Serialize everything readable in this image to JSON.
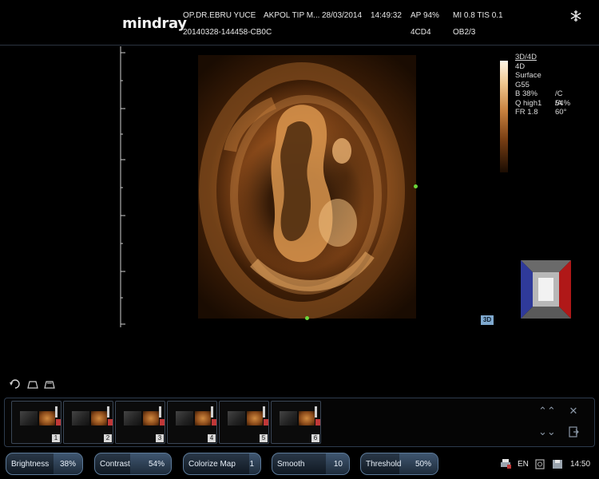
{
  "header": {
    "brand": "mindray",
    "doctor": "OP.DR.EBRU YUCE",
    "hospital": "AKPOL TIP M...",
    "date": "28/03/2014",
    "time": "14:49:32",
    "ap": "AP  94%",
    "mi_tis": "MI 0.8  TIS 0.1",
    "exam_id": "20140328-144458-CB0C",
    "probe": "4CD4",
    "preset": "OB2/3"
  },
  "params": {
    "mode": "3D/4D",
    "lines": [
      "4D",
      "Surface",
      "G55",
      "B 38%",
      "Q high1",
      "FR 1.8"
    ],
    "col2": [
      "/C 54%",
      "/A 60°"
    ]
  },
  "badge_3d": "3D",
  "icons": {
    "settings": "snowflake-icon",
    "rotate": "rotate-icon",
    "render_box1": "render-box-icon",
    "render_box2": "render-box-alt-icon",
    "orientation": "orientation-cube-icon",
    "up": "double-chevron-up-icon",
    "down": "double-chevron-down-icon",
    "close": "close-icon",
    "export": "export-icon",
    "printer": "printer-icon",
    "lang": "EN",
    "recycle": "recycle-icon",
    "disk": "disk-icon"
  },
  "thumbnails": [
    {
      "num": "1"
    },
    {
      "num": "2"
    },
    {
      "num": "3"
    },
    {
      "num": "4"
    },
    {
      "num": "5"
    },
    {
      "num": "6"
    }
  ],
  "controls": [
    {
      "label": "Brightness",
      "value": "38%",
      "level": 0.38
    },
    {
      "label": "Contrast",
      "value": "54%",
      "level": 0.54
    },
    {
      "label": "Colorize Map",
      "value": "1",
      "level": 0.15
    },
    {
      "label": "Smooth",
      "value": "10",
      "level": 0.3
    },
    {
      "label": "Threshold",
      "value": "50%",
      "level": 0.5
    }
  ],
  "tray": {
    "lang": "EN",
    "clock": "14:50"
  },
  "colors": {
    "accent": "#5c7a9a",
    "focus_marker": "#6bd63a",
    "badge": "#7fa9cf"
  }
}
